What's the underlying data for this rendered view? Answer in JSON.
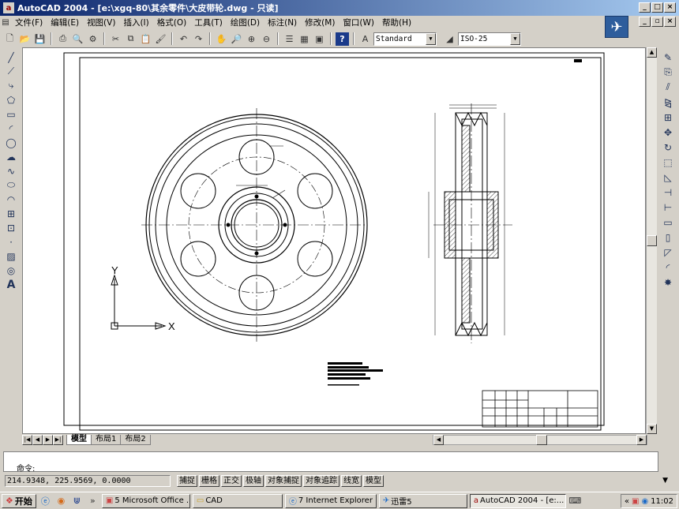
{
  "window": {
    "title": "AutoCAD 2004 - [e:\\xgq-80\\其余零件\\大皮带轮.dwg - 只读]"
  },
  "menu": [
    "文件(F)",
    "编辑(E)",
    "视图(V)",
    "插入(I)",
    "格式(O)",
    "工具(T)",
    "绘图(D)",
    "标注(N)",
    "修改(M)",
    "窗口(W)",
    "帮助(H)"
  ],
  "toolbar": {
    "text_style": "Standard",
    "dim_style": "ISO-25"
  },
  "ucs": {
    "x_label": "X",
    "y_label": "Y"
  },
  "tabs": {
    "model": "模型",
    "layout1": "布局1",
    "layout2": "布局2"
  },
  "command": {
    "prompt": "命令:"
  },
  "status": {
    "coords": "214.9348, 225.9569, 0.0000",
    "buttons": [
      "捕捉",
      "栅格",
      "正交",
      "极轴",
      "对象捕捉",
      "对象追踪",
      "线宽",
      "模型"
    ]
  },
  "taskbar": {
    "start": "开始",
    "tasks": [
      "5 Microsoft Office ...",
      "CAD",
      "7 Internet Explorer",
      "迅雷5",
      "AutoCAD 2004 - [e:..."
    ],
    "clock": "11:02"
  },
  "icons": {
    "app": "autocad-icon",
    "logo": "autocad-logo-icon"
  }
}
